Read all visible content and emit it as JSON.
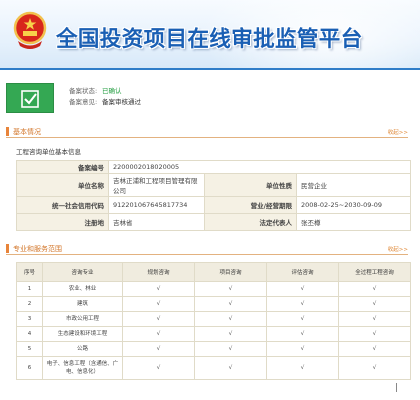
{
  "banner": {
    "title": "全国投资项目在线审批监管平台"
  },
  "status": {
    "state_label": "备案状态:",
    "state_value": "已确认",
    "opinion_label": "备案意见:",
    "opinion_value": "备案审核通过"
  },
  "basic": {
    "section_title": "基本情况",
    "more": "收起>>",
    "sub_title": "工程咨询单位基本信息",
    "rows": [
      {
        "l1": "备案编号",
        "v1": "2200002018020005",
        "l2": "",
        "v2": ""
      },
      {
        "l1": "单位名称",
        "v1": "吉林正浦和工程项目管理有限公司",
        "l2": "单位性质",
        "v2": "民营企业"
      },
      {
        "l1": "统一社会信用代码",
        "v1": "91220106764581773​4",
        "l2": "营业/经营期限",
        "v2": "2008-02-25~2030-09-09"
      },
      {
        "l1": "注册地",
        "v1": "吉林省",
        "l2": "法定代表人",
        "v2": "张丕樽"
      }
    ]
  },
  "scope": {
    "section_title": "专业和服务范围",
    "more": "收起>>",
    "headers": [
      "序号",
      "咨询专业",
      "规划咨询",
      "项目咨询",
      "评估咨询",
      "全过程工程咨询"
    ],
    "rows": [
      [
        "1",
        "农业、林业",
        "√",
        "√",
        "√",
        "√"
      ],
      [
        "2",
        "建筑",
        "√",
        "√",
        "√",
        "√"
      ],
      [
        "3",
        "市政公用工程",
        "√",
        "√",
        "√",
        "√"
      ],
      [
        "4",
        "生态建设和环境工程",
        "√",
        "√",
        "√",
        "√"
      ],
      [
        "5",
        "公路",
        "√",
        "√",
        "√",
        "√"
      ],
      [
        "6",
        "电子、信息工程（含通信、广电、信息化）",
        "√",
        "√",
        "√",
        "√"
      ]
    ]
  },
  "colors": {
    "accent": "#e8843a",
    "brand": "#1a5fb4",
    "ok": "#34a853"
  }
}
